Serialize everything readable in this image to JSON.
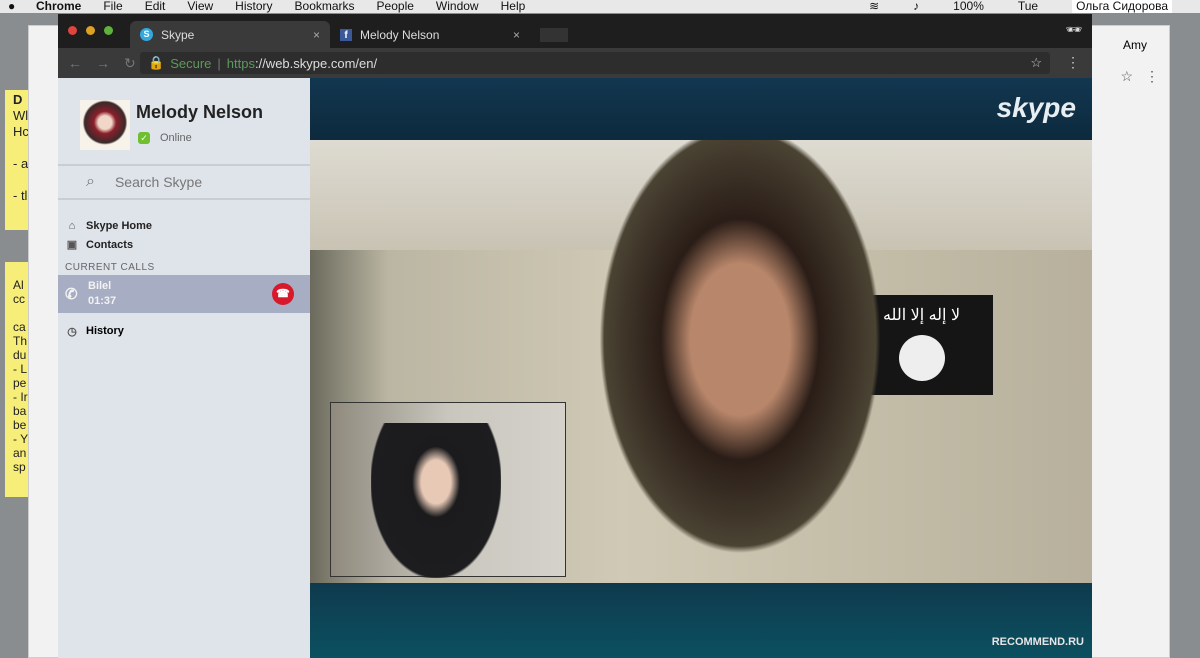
{
  "menubar": {
    "apple": "",
    "app": "Chrome",
    "items": [
      "File",
      "Edit",
      "View",
      "History",
      "Bookmarks",
      "People",
      "Window",
      "Help"
    ],
    "battery": "100%",
    "day": "Tue",
    "user": "Ольга Сидорова"
  },
  "desktop": {
    "notes_top": [
      "D",
      "Wl",
      "Hc",
      "- a",
      "- tl"
    ],
    "notes_bottom": [
      "Al",
      "cc",
      "ca",
      "Th",
      "du",
      "- L",
      "pe",
      "- Ir",
      "ba",
      "be",
      "- Y",
      "an",
      "sp"
    ]
  },
  "back_window": {
    "tab": "Amy"
  },
  "tabs": [
    {
      "label": "Skype",
      "icon": "skype-icon",
      "active": true
    },
    {
      "label": "Melody Nelson",
      "icon": "facebook-icon",
      "active": false
    }
  ],
  "address": {
    "secure": "Secure",
    "scheme": "https",
    "rest": "://web.skype.com/en/"
  },
  "sidebar": {
    "name": "Melody Nelson",
    "status": "Online",
    "search_placeholder": "Search Skype",
    "links": [
      "Skype Home",
      "Contacts"
    ],
    "current_calls_label": "CURRENT CALLS",
    "call": {
      "name": "Bilel",
      "duration": "01:37"
    },
    "history": "History"
  },
  "video": {
    "logo": "skype",
    "flag_text": "لا إله إلا الله",
    "watermark": "RECOMMEND.RU"
  },
  "colors": {
    "hangup": "#d8192b",
    "online": "#6fbf2e",
    "skype": "#34a9e0"
  }
}
